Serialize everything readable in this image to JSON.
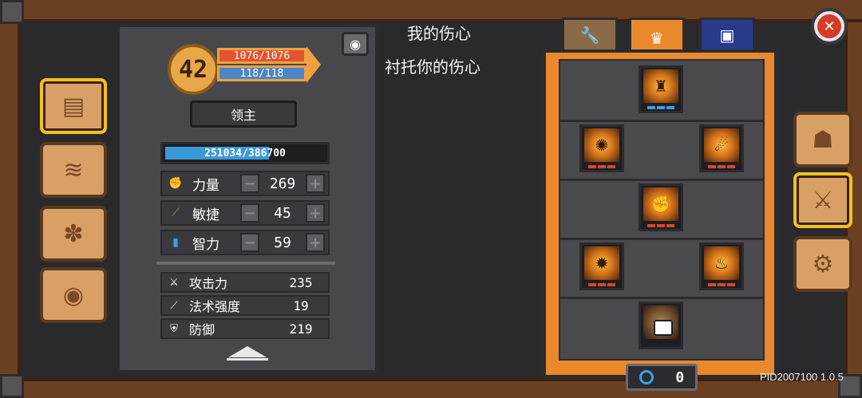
{
  "character": {
    "level": "42",
    "hp": "1076/1076",
    "mp": "118/118",
    "title": "领主",
    "exp": "251034/386700",
    "exp_fraction": 0.649
  },
  "stats": [
    {
      "label": "力量",
      "value": "269",
      "icon": "fist-icon",
      "color": "#d8462a"
    },
    {
      "label": "敏捷",
      "value": "45",
      "icon": "feather-icon",
      "color": "#5ab040"
    },
    {
      "label": "智力",
      "value": "59",
      "icon": "book-icon",
      "color": "#3aa0e8"
    }
  ],
  "attributes": [
    {
      "label": "攻击力",
      "value": "235",
      "icon": "sword-icon"
    },
    {
      "label": "法术强度",
      "value": "19",
      "icon": "wand-icon"
    },
    {
      "label": "防御",
      "value": "219",
      "icon": "shield-icon"
    }
  ],
  "quote": {
    "line1": "我的伤心",
    "line2": "衬托你的伤心"
  },
  "currency": {
    "value": "0"
  },
  "version": "PID2007100 1.0.5",
  "left_tabs": [
    "book-icon",
    "map-icon",
    "paw-icon",
    "bell-icon"
  ],
  "right_tabs": [
    "helmet-icon",
    "skills-icon",
    "settings-icon"
  ],
  "skill_tabs": [
    "wrench-icon",
    "crown-icon",
    "armor-icon"
  ],
  "colors": {
    "accent": "#e9892c",
    "frame": "#6b3f22"
  }
}
